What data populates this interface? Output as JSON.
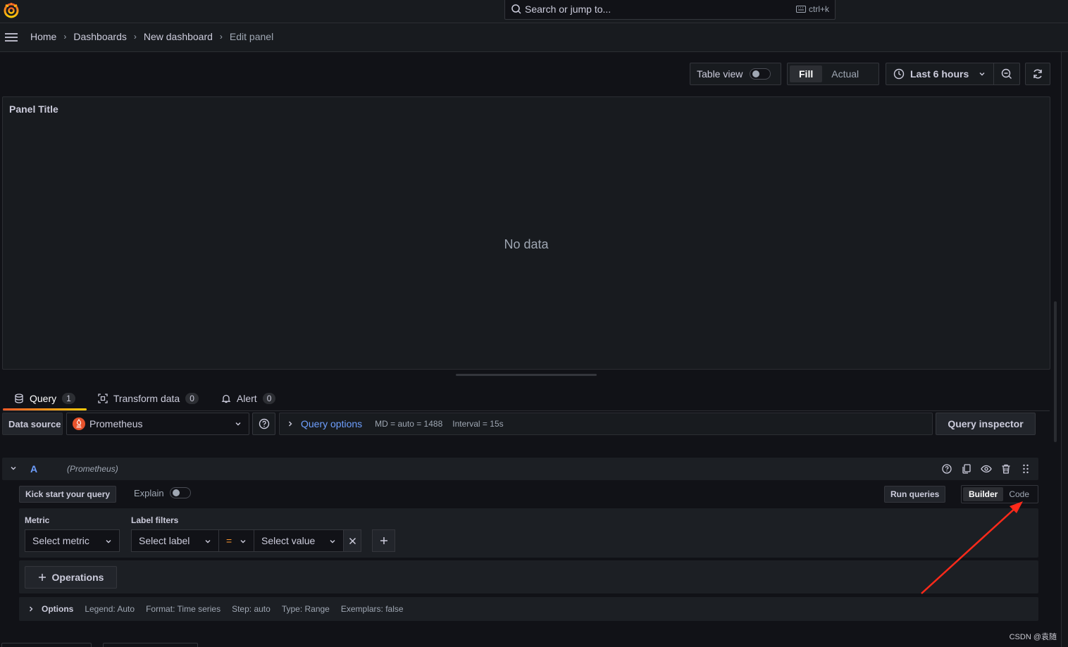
{
  "search": {
    "placeholder": "Search or jump to...",
    "shortcut": "ctrl+k"
  },
  "breadcrumb": {
    "items": [
      "Home",
      "Dashboards",
      "New dashboard"
    ],
    "current": "Edit panel"
  },
  "toolbar": {
    "table_view_label": "Table view",
    "fill_label": "Fill",
    "actual_label": "Actual",
    "time_range": "Last 6 hours"
  },
  "panel": {
    "title": "Panel Title",
    "empty_message": "No data"
  },
  "tabs": [
    {
      "label": "Query",
      "count": "1"
    },
    {
      "label": "Transform data",
      "count": "0"
    },
    {
      "label": "Alert",
      "count": "0"
    }
  ],
  "datasource": {
    "label": "Data source",
    "selected": "Prometheus",
    "query_options_label": "Query options",
    "md": "MD = auto = 1488",
    "interval": "Interval = 15s",
    "inspector_label": "Query inspector"
  },
  "query": {
    "letter": "A",
    "datasource_name": "(Prometheus)",
    "kick_start_label": "Kick start your query",
    "explain_label": "Explain",
    "run_label": "Run queries",
    "modes": [
      "Builder",
      "Code"
    ],
    "metric_label": "Metric",
    "metric_placeholder": "Select metric",
    "label_filters_label": "Label filters",
    "label_placeholder": "Select label",
    "operator": "=",
    "value_placeholder": "Select value",
    "operations_label": "Operations",
    "options": {
      "title": "Options",
      "legend": "Legend: Auto",
      "format": "Format: Time series",
      "step": "Step: auto",
      "type": "Type: Range",
      "exemplars": "Exemplars: false"
    }
  },
  "watermark": "CSDN @袁随",
  "colors": {
    "accent_link": "#6e9fff",
    "tab_underline": "#f05a28",
    "annotation_arrow": "#ff2a1a"
  }
}
